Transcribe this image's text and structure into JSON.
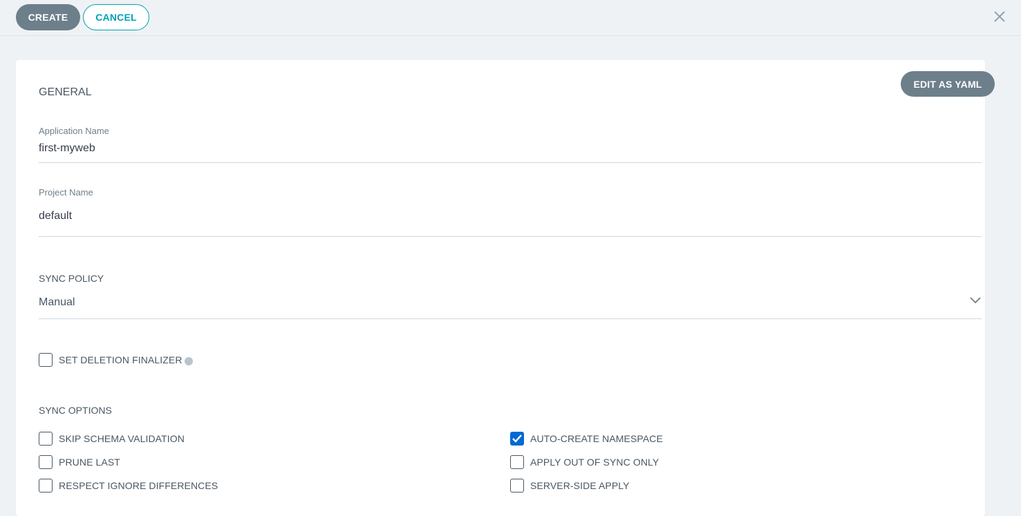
{
  "toolbar": {
    "create_label": "CREATE",
    "cancel_label": "CANCEL"
  },
  "card": {
    "edit_yaml_label": "EDIT AS YAML",
    "general_title": "GENERAL",
    "application_name": {
      "label": "Application Name",
      "value": "first-myweb"
    },
    "project_name": {
      "label": "Project Name",
      "value": "default"
    },
    "sync_policy": {
      "label": "SYNC POLICY",
      "value": "Manual"
    },
    "deletion_finalizer": {
      "label": "SET DELETION FINALIZER",
      "checked": false
    },
    "sync_options": {
      "title": "SYNC OPTIONS",
      "left": [
        {
          "label": "SKIP SCHEMA VALIDATION",
          "checked": false
        },
        {
          "label": "PRUNE LAST",
          "checked": false
        },
        {
          "label": "RESPECT IGNORE DIFFERENCES",
          "checked": false
        }
      ],
      "right": [
        {
          "label": "AUTO-CREATE NAMESPACE",
          "checked": true
        },
        {
          "label": "APPLY OUT OF SYNC ONLY",
          "checked": false
        },
        {
          "label": "SERVER-SIDE APPLY",
          "checked": false
        }
      ]
    }
  },
  "colors": {
    "primary_button": "#6d7f8b",
    "accent": "#00a2b3",
    "checkbox_checked": "#0069d2",
    "background": "#eff2f5"
  }
}
